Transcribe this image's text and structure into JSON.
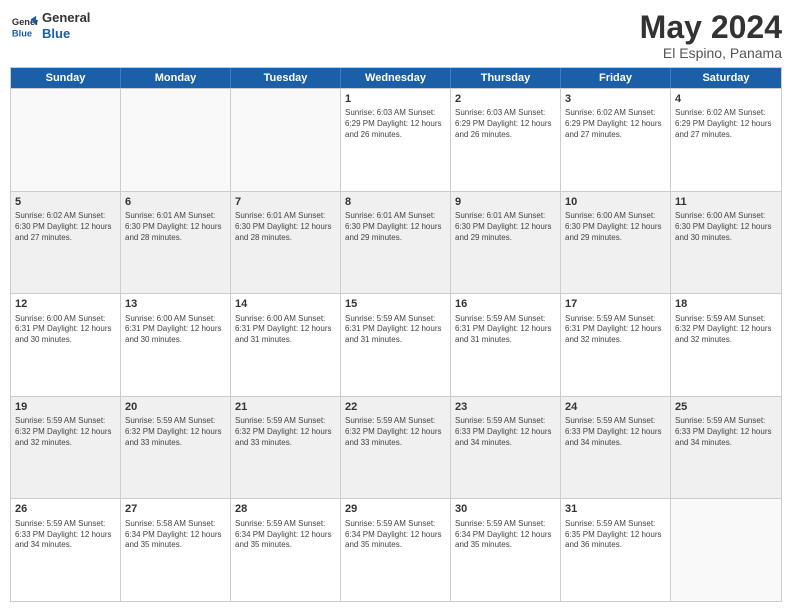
{
  "header": {
    "logo_general": "General",
    "logo_blue": "Blue",
    "title": "May 2024",
    "subtitle": "El Espino, Panama"
  },
  "calendar": {
    "days_of_week": [
      "Sunday",
      "Monday",
      "Tuesday",
      "Wednesday",
      "Thursday",
      "Friday",
      "Saturday"
    ],
    "rows": [
      {
        "cells": [
          {
            "day": "",
            "info": ""
          },
          {
            "day": "",
            "info": ""
          },
          {
            "day": "",
            "info": ""
          },
          {
            "day": "1",
            "info": "Sunrise: 6:03 AM\nSunset: 6:29 PM\nDaylight: 12 hours\nand 26 minutes."
          },
          {
            "day": "2",
            "info": "Sunrise: 6:03 AM\nSunset: 6:29 PM\nDaylight: 12 hours\nand 26 minutes."
          },
          {
            "day": "3",
            "info": "Sunrise: 6:02 AM\nSunset: 6:29 PM\nDaylight: 12 hours\nand 27 minutes."
          },
          {
            "day": "4",
            "info": "Sunrise: 6:02 AM\nSunset: 6:29 PM\nDaylight: 12 hours\nand 27 minutes."
          }
        ]
      },
      {
        "cells": [
          {
            "day": "5",
            "info": "Sunrise: 6:02 AM\nSunset: 6:30 PM\nDaylight: 12 hours\nand 27 minutes."
          },
          {
            "day": "6",
            "info": "Sunrise: 6:01 AM\nSunset: 6:30 PM\nDaylight: 12 hours\nand 28 minutes."
          },
          {
            "day": "7",
            "info": "Sunrise: 6:01 AM\nSunset: 6:30 PM\nDaylight: 12 hours\nand 28 minutes."
          },
          {
            "day": "8",
            "info": "Sunrise: 6:01 AM\nSunset: 6:30 PM\nDaylight: 12 hours\nand 29 minutes."
          },
          {
            "day": "9",
            "info": "Sunrise: 6:01 AM\nSunset: 6:30 PM\nDaylight: 12 hours\nand 29 minutes."
          },
          {
            "day": "10",
            "info": "Sunrise: 6:00 AM\nSunset: 6:30 PM\nDaylight: 12 hours\nand 29 minutes."
          },
          {
            "day": "11",
            "info": "Sunrise: 6:00 AM\nSunset: 6:30 PM\nDaylight: 12 hours\nand 30 minutes."
          }
        ]
      },
      {
        "cells": [
          {
            "day": "12",
            "info": "Sunrise: 6:00 AM\nSunset: 6:31 PM\nDaylight: 12 hours\nand 30 minutes."
          },
          {
            "day": "13",
            "info": "Sunrise: 6:00 AM\nSunset: 6:31 PM\nDaylight: 12 hours\nand 30 minutes."
          },
          {
            "day": "14",
            "info": "Sunrise: 6:00 AM\nSunset: 6:31 PM\nDaylight: 12 hours\nand 31 minutes."
          },
          {
            "day": "15",
            "info": "Sunrise: 5:59 AM\nSunset: 6:31 PM\nDaylight: 12 hours\nand 31 minutes."
          },
          {
            "day": "16",
            "info": "Sunrise: 5:59 AM\nSunset: 6:31 PM\nDaylight: 12 hours\nand 31 minutes."
          },
          {
            "day": "17",
            "info": "Sunrise: 5:59 AM\nSunset: 6:31 PM\nDaylight: 12 hours\nand 32 minutes."
          },
          {
            "day": "18",
            "info": "Sunrise: 5:59 AM\nSunset: 6:32 PM\nDaylight: 12 hours\nand 32 minutes."
          }
        ]
      },
      {
        "cells": [
          {
            "day": "19",
            "info": "Sunrise: 5:59 AM\nSunset: 6:32 PM\nDaylight: 12 hours\nand 32 minutes."
          },
          {
            "day": "20",
            "info": "Sunrise: 5:59 AM\nSunset: 6:32 PM\nDaylight: 12 hours\nand 33 minutes."
          },
          {
            "day": "21",
            "info": "Sunrise: 5:59 AM\nSunset: 6:32 PM\nDaylight: 12 hours\nand 33 minutes."
          },
          {
            "day": "22",
            "info": "Sunrise: 5:59 AM\nSunset: 6:32 PM\nDaylight: 12 hours\nand 33 minutes."
          },
          {
            "day": "23",
            "info": "Sunrise: 5:59 AM\nSunset: 6:33 PM\nDaylight: 12 hours\nand 34 minutes."
          },
          {
            "day": "24",
            "info": "Sunrise: 5:59 AM\nSunset: 6:33 PM\nDaylight: 12 hours\nand 34 minutes."
          },
          {
            "day": "25",
            "info": "Sunrise: 5:59 AM\nSunset: 6:33 PM\nDaylight: 12 hours\nand 34 minutes."
          }
        ]
      },
      {
        "cells": [
          {
            "day": "26",
            "info": "Sunrise: 5:59 AM\nSunset: 6:33 PM\nDaylight: 12 hours\nand 34 minutes."
          },
          {
            "day": "27",
            "info": "Sunrise: 5:58 AM\nSunset: 6:34 PM\nDaylight: 12 hours\nand 35 minutes."
          },
          {
            "day": "28",
            "info": "Sunrise: 5:59 AM\nSunset: 6:34 PM\nDaylight: 12 hours\nand 35 minutes."
          },
          {
            "day": "29",
            "info": "Sunrise: 5:59 AM\nSunset: 6:34 PM\nDaylight: 12 hours\nand 35 minutes."
          },
          {
            "day": "30",
            "info": "Sunrise: 5:59 AM\nSunset: 6:34 PM\nDaylight: 12 hours\nand 35 minutes."
          },
          {
            "day": "31",
            "info": "Sunrise: 5:59 AM\nSunset: 6:35 PM\nDaylight: 12 hours\nand 36 minutes."
          },
          {
            "day": "",
            "info": ""
          }
        ]
      }
    ]
  }
}
